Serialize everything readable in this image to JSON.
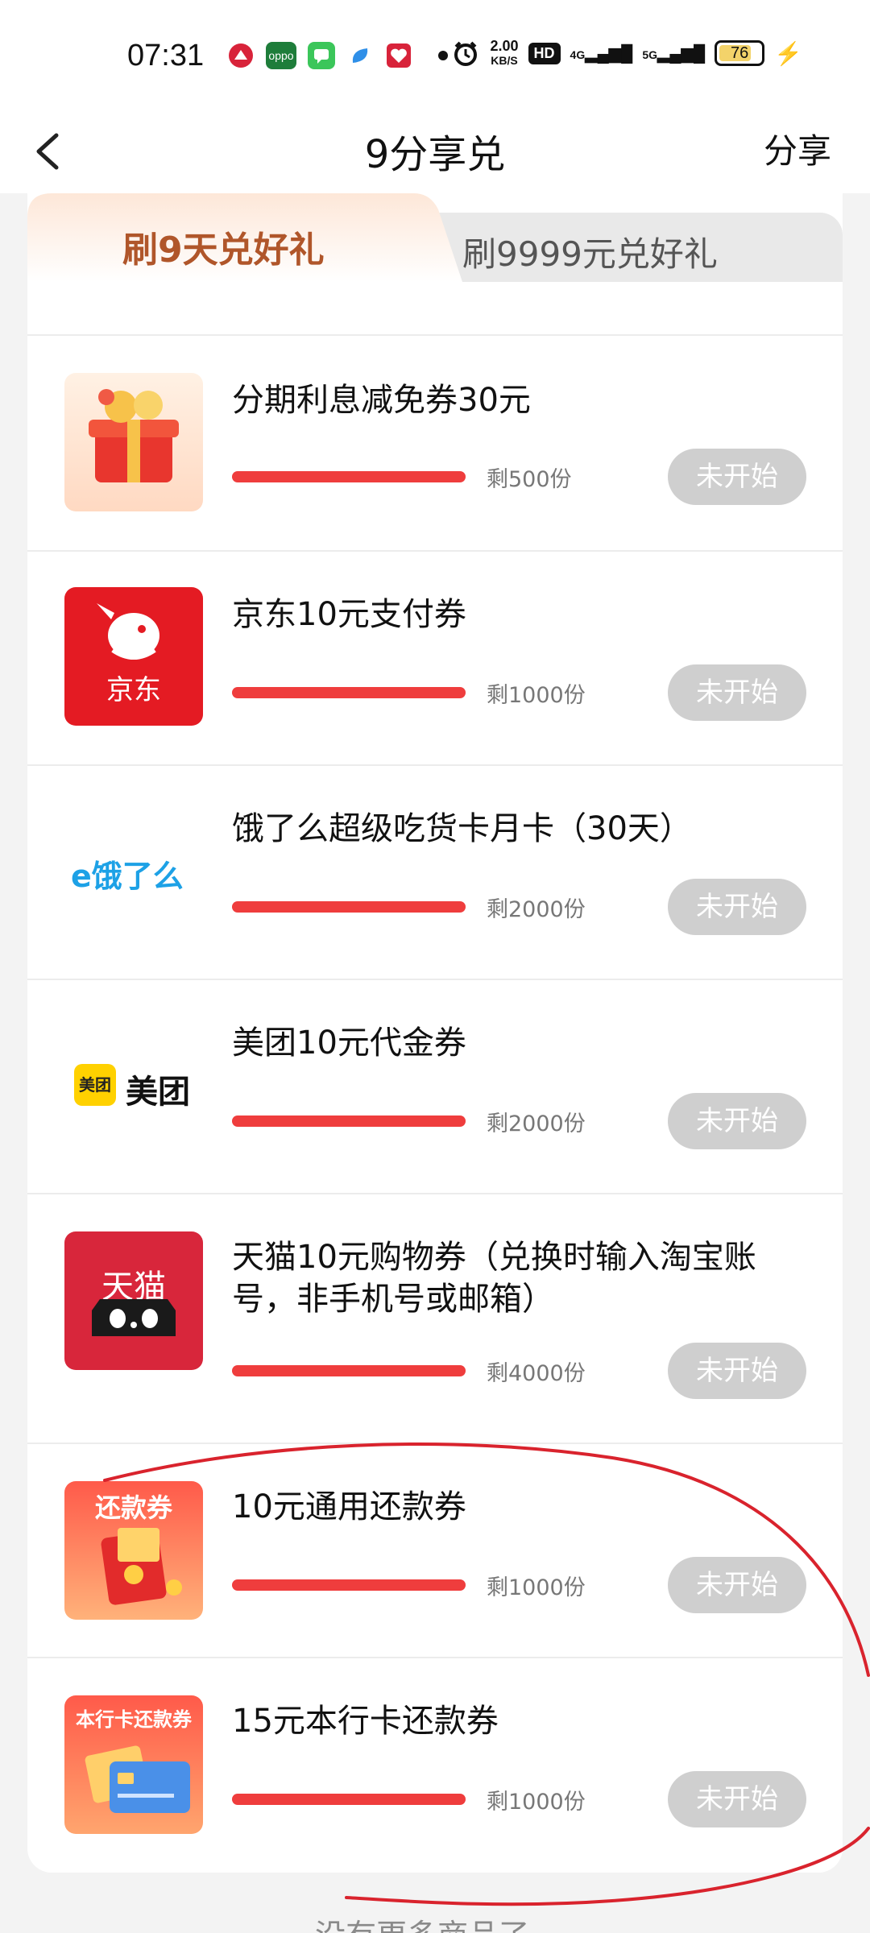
{
  "status_bar": {
    "time": "07:31",
    "apps": [
      "oppo"
    ],
    "speed_value": "2.00",
    "speed_unit": "KB/S",
    "hd": "HD",
    "sig1": "4G",
    "sig2": "5G",
    "battery": "76"
  },
  "nav": {
    "title": "9分享兑",
    "share": "分享"
  },
  "tabs": {
    "active": "刷9天兑好礼",
    "inactive": "刷9999元兑好礼"
  },
  "items": [
    {
      "title": "分期利息减免券30元",
      "remain": "剩500份",
      "button": "未开始",
      "icon": "gift-box-icon"
    },
    {
      "title": "京东10元支付券",
      "remain": "剩1000份",
      "button": "未开始",
      "icon": "jd-logo-icon",
      "logo_text": "京东"
    },
    {
      "title": "饿了么超级吃货卡月卡（30天）",
      "remain": "剩2000份",
      "button": "未开始",
      "icon": "eleme-logo-icon",
      "logo_text": "饿了么"
    },
    {
      "title": "美团10元代金券",
      "remain": "剩2000份",
      "button": "未开始",
      "icon": "meituan-logo-icon",
      "logo_text": "美团",
      "logo_badge": "美团"
    },
    {
      "title": "天猫10元购物券（兑换时输入淘宝账号，非手机号或邮箱）",
      "remain": "剩4000份",
      "button": "未开始",
      "icon": "tmall-logo-icon",
      "logo_text": "天猫"
    },
    {
      "title": "10元通用还款券",
      "remain": "剩1000份",
      "button": "未开始",
      "icon": "repay-coupon-icon",
      "logo_text": "还款券"
    },
    {
      "title": "15元本行卡还款券",
      "remain": "剩1000份",
      "button": "未开始",
      "icon": "bank-card-repay-icon",
      "logo_text": "本行卡还款券"
    }
  ],
  "footer": "没有更多商品了~",
  "colors": {
    "accent": "#ef3d3d",
    "tab_active": "#b0562a",
    "button_disabled": "#cfcfcf"
  }
}
